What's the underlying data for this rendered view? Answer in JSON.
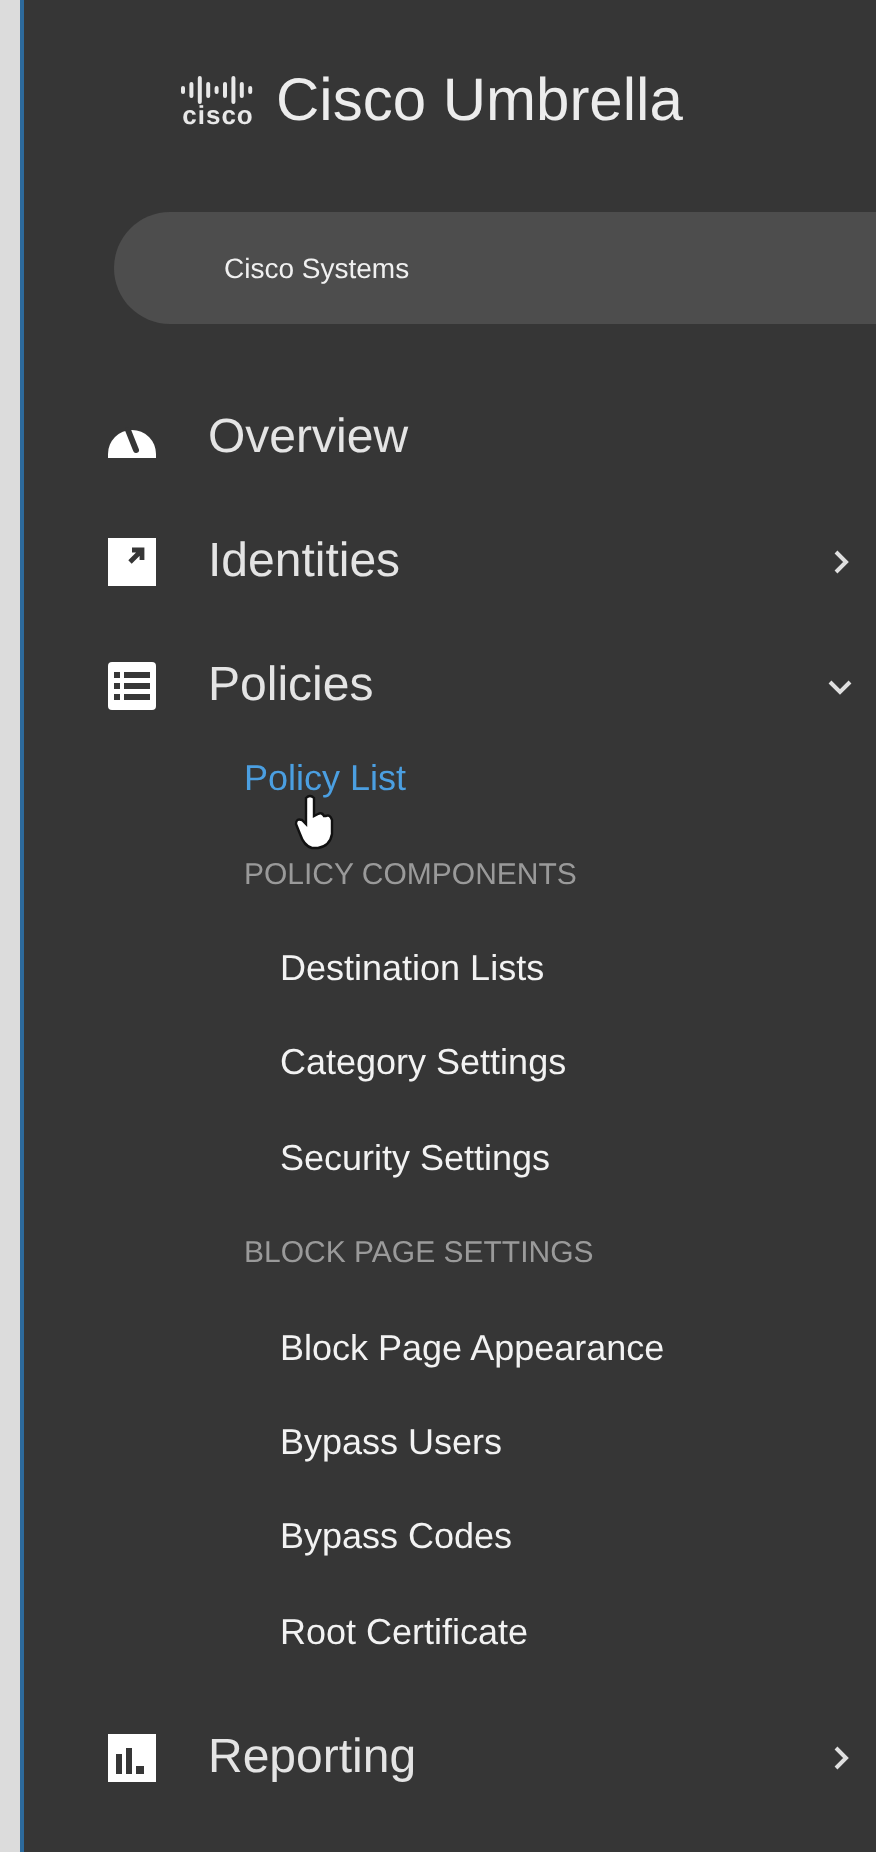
{
  "logo": {
    "mark": "cisco",
    "title": "Cisco Umbrella"
  },
  "account": {
    "name": "Cisco Systems"
  },
  "nav": [
    {
      "label": "Overview"
    },
    {
      "label": "Identities",
      "expanded": false
    },
    {
      "label": "Policies",
      "expanded": true,
      "children": [
        {
          "kind": "link",
          "label": "Policy List",
          "selected": true,
          "hovered": true
        },
        {
          "kind": "section",
          "label": "POLICY COMPONENTS"
        },
        {
          "kind": "link",
          "label": "Destination Lists",
          "selected": false
        },
        {
          "kind": "link",
          "label": "Category Settings",
          "selected": false
        },
        {
          "kind": "link",
          "label": "Security Settings",
          "selected": false
        },
        {
          "kind": "section",
          "label": "BLOCK PAGE SETTINGS"
        },
        {
          "kind": "link",
          "label": "Block Page Appearance",
          "selected": false
        },
        {
          "kind": "link",
          "label": "Bypass Users",
          "selected": false
        },
        {
          "kind": "link",
          "label": "Bypass Codes",
          "selected": false
        },
        {
          "kind": "link",
          "label": "Root Certificate",
          "selected": false
        }
      ]
    },
    {
      "label": "Reporting",
      "expanded": false
    }
  ]
}
